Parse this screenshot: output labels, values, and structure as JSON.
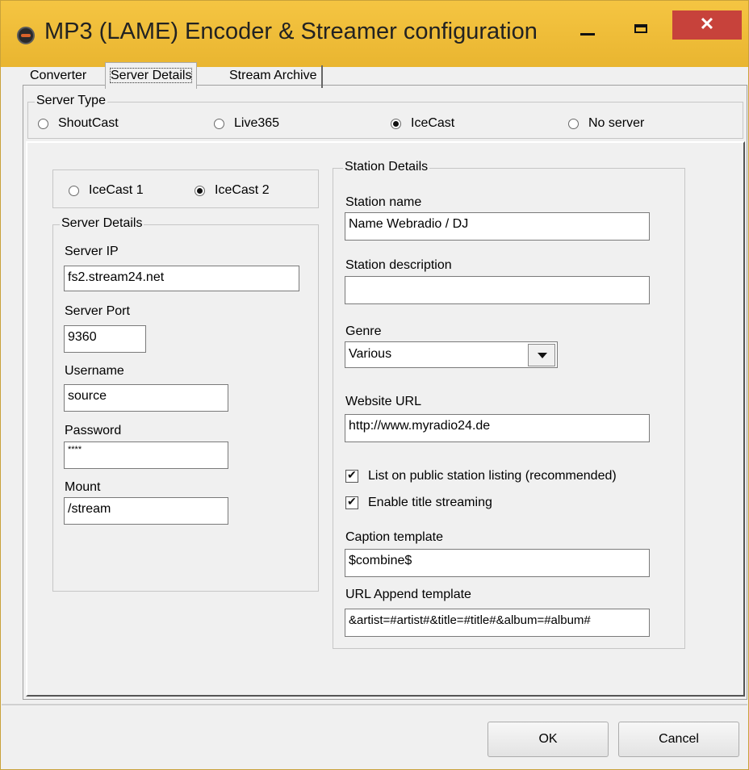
{
  "window": {
    "title": "MP3 (LAME) Encoder & Streamer configuration",
    "close_glyph": "✕"
  },
  "tabs": [
    {
      "label": "Converter"
    },
    {
      "label": "Server Details"
    },
    {
      "label": "Stream Archive"
    }
  ],
  "server_type": {
    "title": "Server Type",
    "options": [
      {
        "label": "ShoutCast",
        "selected": false
      },
      {
        "label": "Live365",
        "selected": false
      },
      {
        "label": "IceCast",
        "selected": true
      },
      {
        "label": "No server",
        "selected": false
      }
    ]
  },
  "icecast_version": {
    "options": [
      {
        "label": "IceCast 1",
        "selected": false
      },
      {
        "label": "IceCast 2",
        "selected": true
      }
    ]
  },
  "server_details": {
    "title": "Server Details",
    "ip_label": "Server IP",
    "ip_value": "fs2.stream24.net",
    "port_label": "Server Port",
    "port_value": "9360",
    "username_label": "Username",
    "username_value": "source",
    "password_label": "Password",
    "password_value": "****",
    "mount_label": "Mount",
    "mount_value": "/stream"
  },
  "station_details": {
    "title": "Station Details",
    "name_label": "Station name",
    "name_value": "Name Webradio / DJ",
    "description_label": "Station description",
    "description_value": "",
    "genre_label": "Genre",
    "genre_value": "Various",
    "website_label": "Website URL",
    "website_value": "http://www.myradio24.de",
    "public_listing_label": "List on public station listing (recommended)",
    "public_listing_checked": true,
    "title_streaming_label": "Enable title streaming",
    "title_streaming_checked": true,
    "caption_label": "Caption template",
    "caption_value": "$combine$",
    "url_append_label": "URL Append template",
    "url_append_value": "&artist=#artist#&title=#title#&album=#album#"
  },
  "buttons": {
    "ok": "OK",
    "cancel": "Cancel"
  }
}
